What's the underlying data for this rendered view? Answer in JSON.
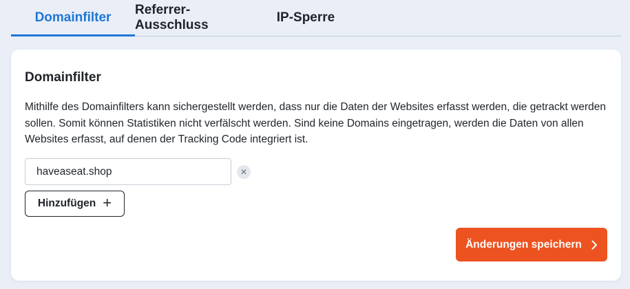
{
  "tabs": [
    {
      "label": "Domainfilter",
      "active": true
    },
    {
      "label": "Referrer-Ausschluss",
      "active": false
    },
    {
      "label": "IP-Sperre",
      "active": false
    }
  ],
  "card": {
    "title": "Domainfilter",
    "description": "Mithilfe des Domainfilters kann sichergestellt werden, dass nur die Daten der Websites erfasst werden, die getrackt werden sollen. Somit können Statistiken nicht verfälscht werden. Sind keine Domains eingetragen, werden die Daten von allen Websites erfasst, auf denen der Tracking Code integriert ist.",
    "domains": [
      "haveaseat.shop"
    ],
    "remove_icon": "close-icon",
    "add_label": "Hinzufügen",
    "add_icon": "plus-icon",
    "save_label": "Änderungen speichern",
    "save_icon": "chevron-right-icon"
  },
  "colors": {
    "accent": "#1e76d6",
    "save_button": "#ed5320",
    "background": "#e9eef7"
  }
}
